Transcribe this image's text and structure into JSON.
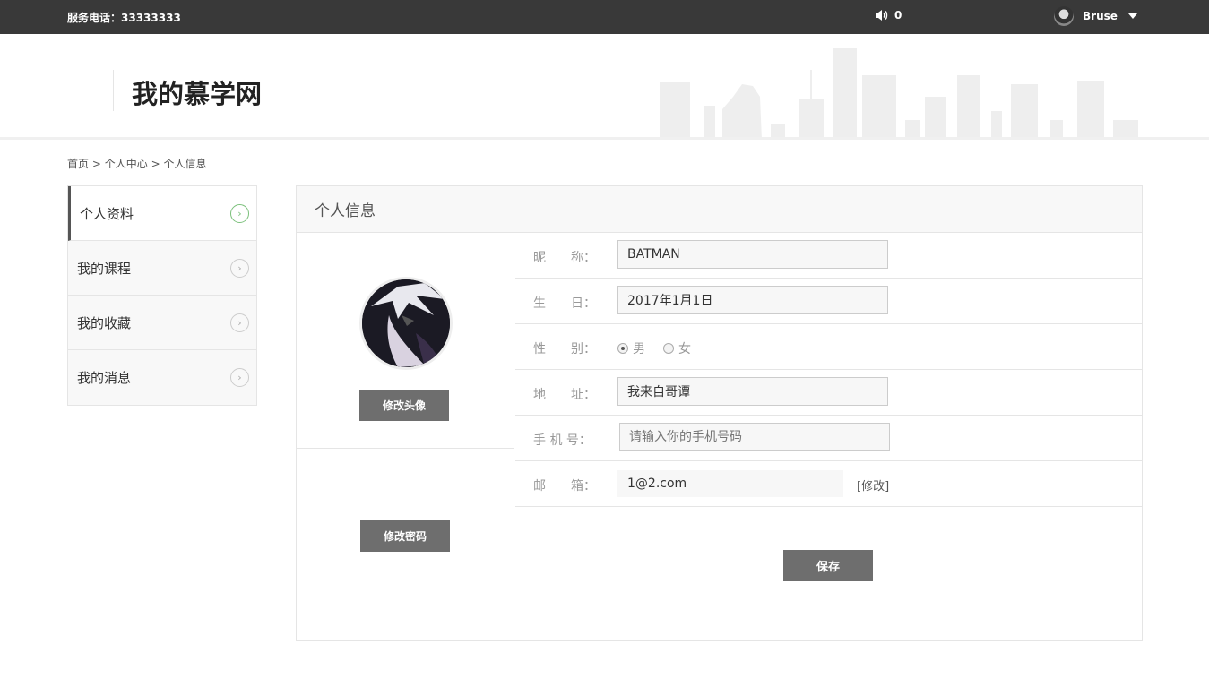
{
  "topbar": {
    "phone": "服务电话：33333333",
    "message_count": "0",
    "username": "Bruse"
  },
  "header": {
    "title": "我的慕学网"
  },
  "breadcrumb": {
    "home": "首页",
    "sep": ">",
    "center": "个人中心",
    "current": "个人信息"
  },
  "sidebar": {
    "items": [
      {
        "label": "个人资料",
        "active": true
      },
      {
        "label": "我的课程",
        "active": false
      },
      {
        "label": "我的收藏",
        "active": false
      },
      {
        "label": "我的消息",
        "active": false
      }
    ]
  },
  "panel": {
    "title": "个人信息",
    "change_avatar": "修改头像",
    "change_password": "修改密码"
  },
  "form": {
    "nickname_label": "昵　　称：",
    "nickname_value": "BATMAN",
    "birthday_label": "生　　日：",
    "birthday_value": "2017年1月1日",
    "gender_label": "性　　别：",
    "gender_male": "男",
    "gender_female": "女",
    "gender_selected": "男",
    "address_label": "地　　址：",
    "address_value": "我来自哥谭",
    "mobile_label": "手 机 号：",
    "mobile_placeholder": "请输入你的手机号码",
    "email_label": "邮　　箱：",
    "email_value": "1@2.com",
    "email_edit": "[修改]",
    "save": "保存"
  }
}
